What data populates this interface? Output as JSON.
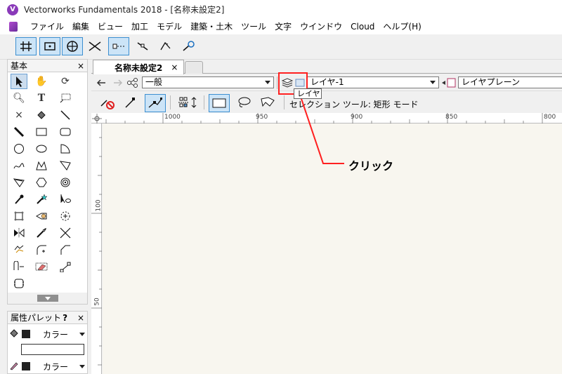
{
  "window": {
    "title": "Vectorworks Fundamentals 2018 - [名称未設定2]",
    "logo_letter": "V"
  },
  "menu": [
    "ファイル",
    "編集",
    "ビュー",
    "加工",
    "モデル",
    "建築・土木",
    "ツール",
    "文字",
    "ウインドウ",
    "Cloud",
    "ヘルプ(H)"
  ],
  "tool_palette": {
    "title": "基本",
    "close": "×"
  },
  "attributes_palette": {
    "title": "属性パレット",
    "help": "?",
    "close": "×",
    "fill_label": "カラー",
    "pen_label": "カラー"
  },
  "document_tab": {
    "label": "名称未設定2",
    "close": "×"
  },
  "view_bar": {
    "class_value": "一般",
    "layer_value": "レイヤ-1",
    "plane_value": "レイヤプレーン"
  },
  "tooltip": "レイヤ",
  "mode_bar": {
    "status": "セレクション ツール: 矩形 モード"
  },
  "ruler": {
    "h_labels": [
      "1000",
      "950",
      "900",
      "850",
      "800"
    ],
    "v_labels": [
      "100",
      "50"
    ]
  },
  "annotation": {
    "label": "クリック",
    "color": "#ff2020"
  },
  "colors": {
    "highlight": "#ff2020",
    "canvas": "#f8f6ef",
    "selected_tool": "#cce4f7"
  }
}
